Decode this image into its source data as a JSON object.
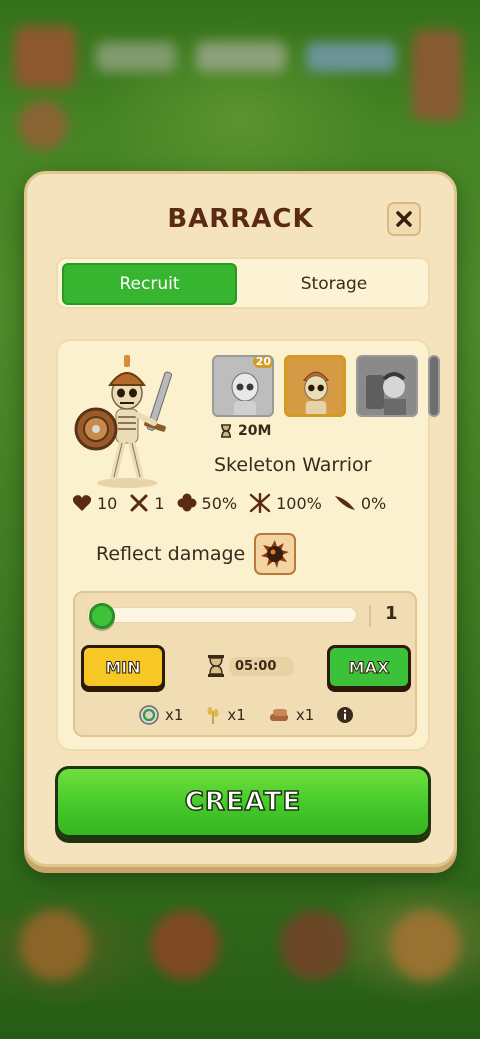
{
  "dialog": {
    "title": "BARRACK",
    "close_icon": "close-icon"
  },
  "tabs": [
    {
      "label": "Recruit",
      "active": true
    },
    {
      "label": "Storage",
      "active": false
    }
  ],
  "unit": {
    "name": "Skeleton Warrior",
    "train_time": "20M",
    "thumbnails": [
      {
        "badge": "20",
        "selected": false
      },
      {
        "badge": "",
        "selected": true
      },
      {
        "badge": "",
        "selected": false
      }
    ],
    "stats": [
      {
        "icon": "heart-icon",
        "value": "10"
      },
      {
        "icon": "crossed-swords-icon",
        "value": "1"
      },
      {
        "icon": "clover-icon",
        "value": "50%"
      },
      {
        "icon": "crossed-blades-icon",
        "value": "100%"
      },
      {
        "icon": "feather-icon",
        "value": "0%"
      }
    ],
    "ability_label": "Reflect damage",
    "ability_icon": "spiked-ball-icon"
  },
  "recruit": {
    "quantity": "1",
    "quantity_fraction": 0.0,
    "min_label": "MIN",
    "max_label": "MAX",
    "timer": "05:00",
    "costs": [
      {
        "icon": "gold-coin-icon",
        "amount": "x1"
      },
      {
        "icon": "wheat-icon",
        "amount": "x1"
      },
      {
        "icon": "wood-icon",
        "amount": "x1"
      }
    ],
    "info_icon": "info-icon"
  },
  "create_label": "CREATE",
  "colors": {
    "panel": "#f5e3bd",
    "title": "#5a2b12",
    "primary_green": "#37b531",
    "min_yellow": "#f7c825"
  }
}
